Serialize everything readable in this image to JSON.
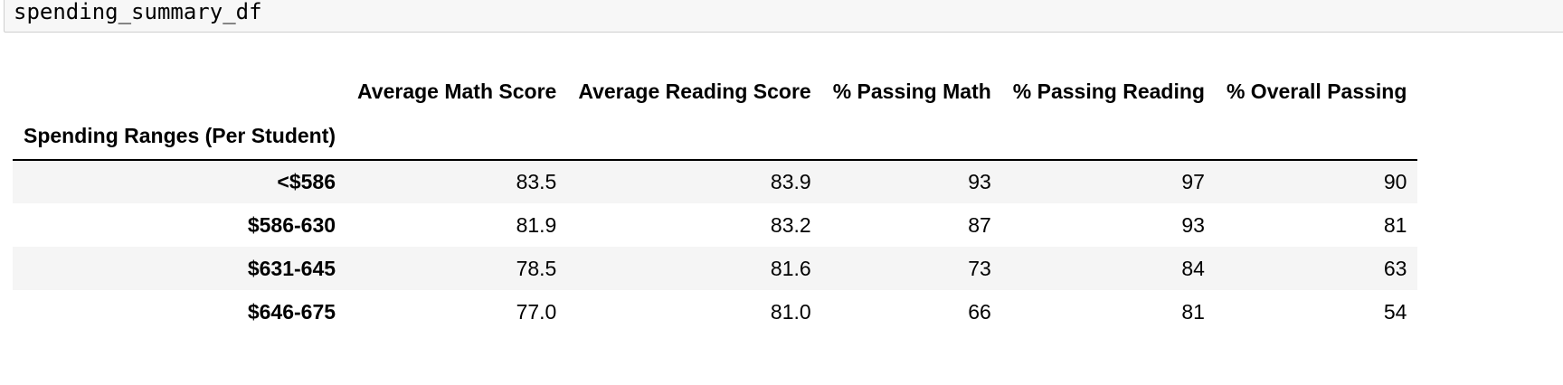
{
  "code_cell": {
    "text": "spending_summary_df"
  },
  "table": {
    "index_name": "Spending Ranges (Per Student)",
    "columns": [
      "Average Math Score",
      "Average Reading Score",
      "% Passing Math",
      "% Passing Reading",
      "% Overall Passing"
    ],
    "rows": [
      {
        "index": "<$586",
        "values": [
          "83.5",
          "83.9",
          "93",
          "97",
          "90"
        ]
      },
      {
        "index": "$586-630",
        "values": [
          "81.9",
          "83.2",
          "87",
          "93",
          "81"
        ]
      },
      {
        "index": "$631-645",
        "values": [
          "78.5",
          "81.6",
          "73",
          "84",
          "63"
        ]
      },
      {
        "index": "$646-675",
        "values": [
          "77.0",
          "81.0",
          "66",
          "81",
          "54"
        ]
      }
    ]
  }
}
